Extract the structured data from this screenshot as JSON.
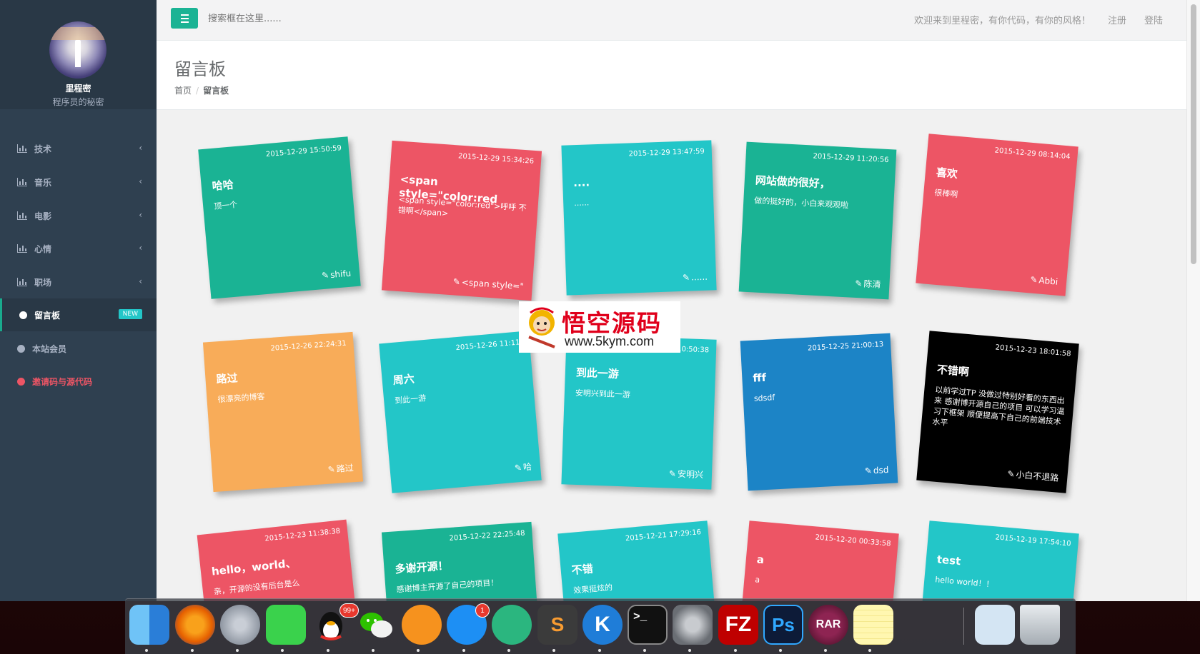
{
  "sidebar": {
    "site_name": "里程密",
    "site_subtitle": "程序员的秘密",
    "items": [
      {
        "label": "技术",
        "icon": "bar-chart-icon",
        "expandable": true
      },
      {
        "label": "音乐",
        "icon": "bar-chart-icon",
        "expandable": true
      },
      {
        "label": "电影",
        "icon": "bar-chart-icon",
        "expandable": true
      },
      {
        "label": "心情",
        "icon": "bar-chart-icon",
        "expandable": true
      },
      {
        "label": "职场",
        "icon": "bar-chart-icon",
        "expandable": true
      },
      {
        "label": "留言板",
        "icon": "globe-icon",
        "badge": "NEW",
        "active": true
      },
      {
        "label": "本站会员",
        "icon": "globe-icon"
      },
      {
        "label": "邀请码与源代码",
        "icon": "globe-icon",
        "highlight_color": "#ed5565"
      }
    ],
    "chevron": "‹"
  },
  "topbar": {
    "search_placeholder": "搜索框在这里......",
    "welcome": "欢迎来到里程密，有你代码，有你的风格！",
    "register": "注册",
    "login": "登陆",
    "accent_color": "#1ab394"
  },
  "heading": {
    "title": "留言板",
    "breadcrumb": [
      "首页",
      "留言板"
    ],
    "separator": "/"
  },
  "notes": [
    {
      "date": "2015-12-29 15:50:59",
      "title": "哈哈",
      "body": "顶一个",
      "author": "shifu",
      "color": "green"
    },
    {
      "date": "2015-12-29 15:34:26",
      "title": "<span style=\"color:red",
      "body": "<span style=\"color:red\">呼呼 不错啊</span>",
      "author": "<span style=\"",
      "color": "red"
    },
    {
      "date": "2015-12-29 13:47:59",
      "title": "....",
      "body": "......",
      "author": "......",
      "color": "cyan"
    },
    {
      "date": "2015-12-29 11:20:56",
      "title": "网站做的很好，",
      "body": "做的挺好的，小白来观观啦",
      "author": "陈清",
      "color": "green"
    },
    {
      "date": "2015-12-29 08:14:04",
      "title": "喜欢",
      "body": "很棒啊",
      "author": "Abbi",
      "color": "red"
    },
    {
      "date": "2015-12-26 22:24:31",
      "title": "路过",
      "body": "很漂亮的博客",
      "author": "路过",
      "color": "orange"
    },
    {
      "date": "2015-12-26 11:11:",
      "title": "周六",
      "body": "到此一游",
      "author": "哈",
      "color": "cyan"
    },
    {
      "date": "2015-12-26 10:50:38",
      "title": "到此一游",
      "body": "安明兴到此一游",
      "author": "安明兴",
      "color": "cyan"
    },
    {
      "date": "2015-12-25 21:00:13",
      "title": "fff",
      "body": "sdsdf",
      "author": "dsd",
      "color": "blue"
    },
    {
      "date": "2015-12-23 18:01:58",
      "title": "不错啊",
      "body": "以前学过TP 没做过特别好看的东西出来 感谢博开源自己的项目 可以学习温习下框架 顺便提高下自己的前端技术水平",
      "author": "小白不退路",
      "color": "black"
    },
    {
      "date": "2015-12-23 11:38:38",
      "title": "hello，world、",
      "body": "亲，开源的没有后台是么",
      "author": "",
      "color": "red"
    },
    {
      "date": "2015-12-22 22:25:48",
      "title": "多谢开源！",
      "body": "感谢博主开源了自己的项目！",
      "author": "",
      "color": "green"
    },
    {
      "date": "2015-12-21 17:29:16",
      "title": "不错",
      "body": "效果挺炫的",
      "author": "",
      "color": "cyan"
    },
    {
      "date": "2015-12-20 00:33:58",
      "title": "a",
      "body": "a",
      "author": "",
      "color": "red"
    },
    {
      "date": "2015-12-19 17:54:10",
      "title": "test",
      "body": "hello world！！",
      "author": "",
      "color": "cyan"
    }
  ],
  "watermark": {
    "text_cn": "悟空源码",
    "url": "www.5kym.com"
  },
  "dock": {
    "items": [
      {
        "name": "finder-icon",
        "label": ""
      },
      {
        "name": "firefox-icon",
        "label": ""
      },
      {
        "name": "launchpad-icon",
        "label": ""
      },
      {
        "name": "facetime-icon",
        "label": ""
      },
      {
        "name": "qq-icon",
        "label": "",
        "badge": "99+"
      },
      {
        "name": "wechat-icon",
        "label": ""
      },
      {
        "name": "ibooks-icon",
        "label": ""
      },
      {
        "name": "app-store-icon",
        "label": "",
        "badge": "1"
      },
      {
        "name": "atom-icon",
        "label": ""
      },
      {
        "name": "sublime-text-icon",
        "label": "S"
      },
      {
        "name": "kugou-icon",
        "label": "K"
      },
      {
        "name": "terminal-icon",
        "label": ">_"
      },
      {
        "name": "system-preferences-icon",
        "label": ""
      },
      {
        "name": "filezilla-icon",
        "label": "FZ"
      },
      {
        "name": "photoshop-icon",
        "label": "Ps"
      },
      {
        "name": "rar-icon",
        "label": "RAR"
      },
      {
        "name": "notes-icon",
        "label": ""
      },
      {
        "name": "documents-icon",
        "label": ""
      },
      {
        "name": "trash-icon",
        "label": ""
      }
    ]
  }
}
